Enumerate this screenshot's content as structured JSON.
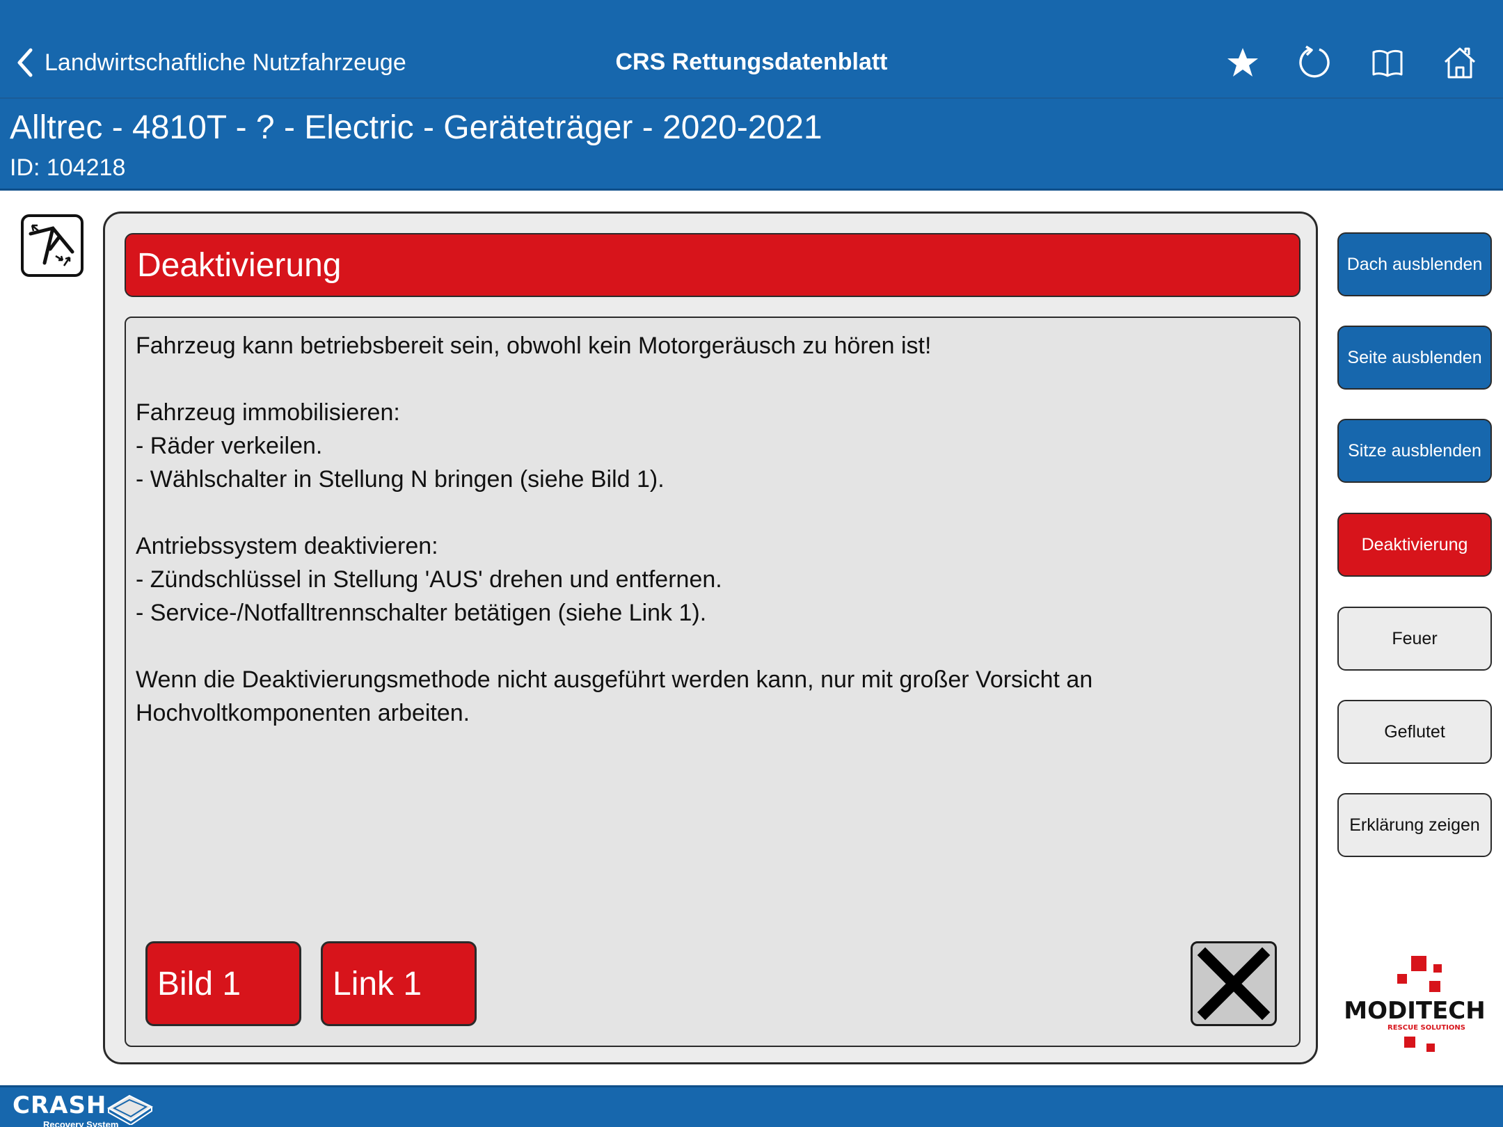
{
  "nav": {
    "back_label": "Landwirtschaftliche Nutzfahrzeuge",
    "title": "CRS Rettungsdatenblatt"
  },
  "vehicle": {
    "title": "Alltrec - 4810T - ? - Electric - Geräteträger - 2020-2021",
    "id": "ID: 104218"
  },
  "panel": {
    "title": "Deaktivierung",
    "paragraphs": [
      [
        "Fahrzeug kann betriebsbereit sein, obwohl kein Motorgeräusch zu hören ist!"
      ],
      [
        "Fahrzeug immobilisieren:",
        "- Räder verkeilen.",
        "- Wählschalter in Stellung N bringen (siehe Bild 1)."
      ],
      [
        "Antriebssystem deaktivieren:",
        "- Zündschlüssel in Stellung 'AUS' drehen und entfernen.",
        "- Service-/Notfalltrennschalter betätigen (siehe Link 1)."
      ],
      [
        "Wenn die Deaktivierungsmethode nicht ausgeführt werden kann, nur mit großer Vorsicht an",
        "Hochvoltkomponenten arbeiten."
      ]
    ],
    "buttons": {
      "bild": "Bild 1",
      "link": "Link 1"
    }
  },
  "menu": [
    {
      "label": "Dach ausblenden",
      "style": "blue"
    },
    {
      "label": "Seite ausblenden",
      "style": "blue"
    },
    {
      "label": "Sitze ausblenden",
      "style": "blue"
    },
    {
      "label": "Deaktivierung",
      "style": "red"
    },
    {
      "label": "Feuer",
      "style": "grey"
    },
    {
      "label": "Geflutet",
      "style": "grey"
    },
    {
      "label": "Erklärung zeigen",
      "style": "grey"
    }
  ],
  "logo": {
    "brand": "MODITECH",
    "tagline": "RESCUE SOLUTIONS"
  },
  "footer": {
    "brand": "CRASH",
    "sub": "Recovery System"
  },
  "icons": {
    "back": "chevron-left-icon",
    "favorite": "star-icon",
    "refresh": "refresh-icon",
    "manual": "book-icon",
    "home": "home-icon"
  },
  "colors": {
    "brand_blue": "#1767ad",
    "alert_red": "#d7141b",
    "panel_grey": "#ececec"
  }
}
